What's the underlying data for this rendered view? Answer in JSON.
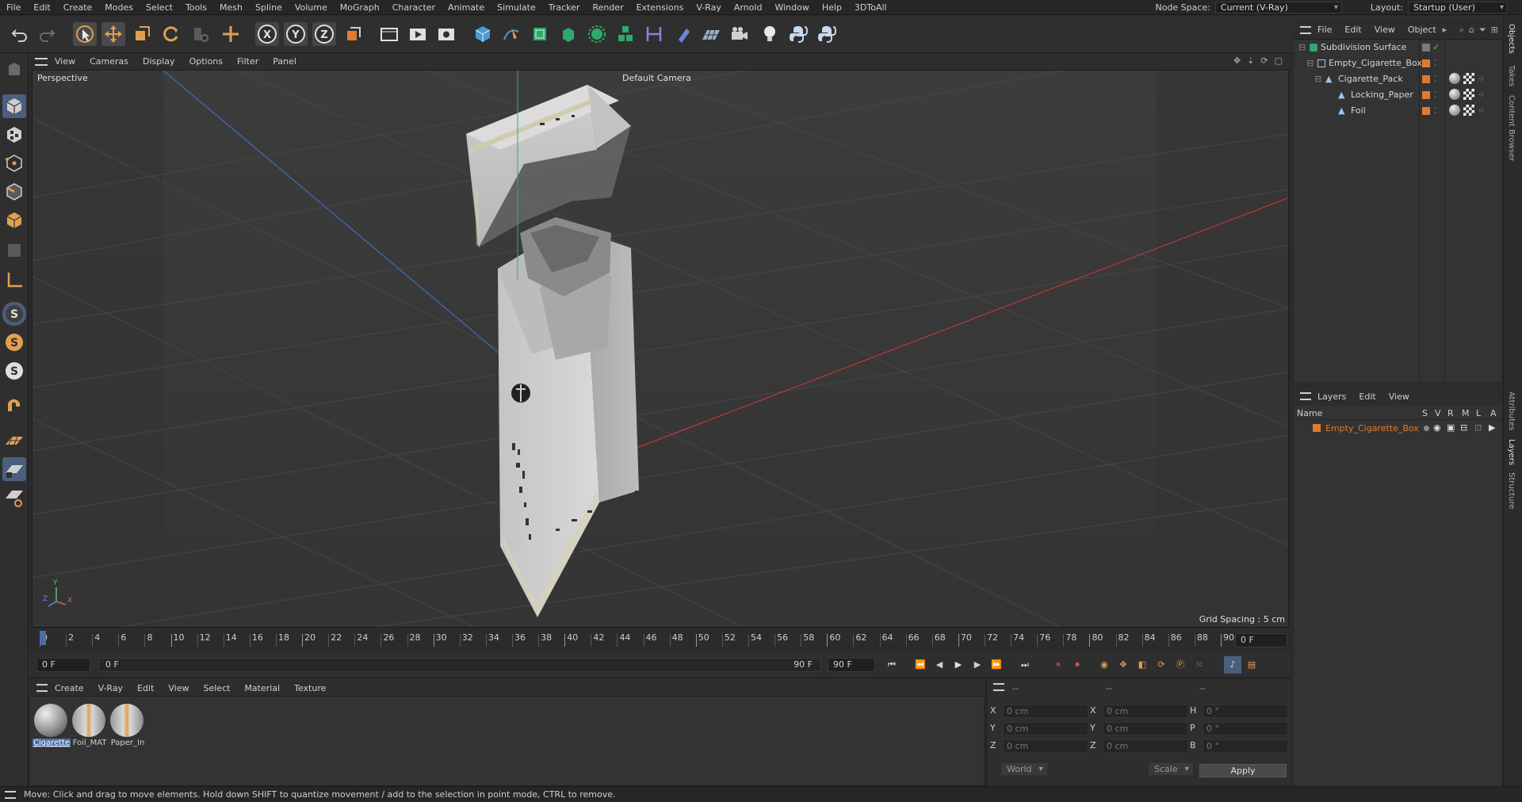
{
  "menubar": {
    "items": [
      "File",
      "Edit",
      "Create",
      "Modes",
      "Select",
      "Tools",
      "Mesh",
      "Spline",
      "Volume",
      "MoGraph",
      "Character",
      "Animate",
      "Simulate",
      "Tracker",
      "Render",
      "Extensions",
      "V-Ray",
      "Arnold",
      "Window",
      "Help",
      "3DToAll"
    ],
    "node_space_label": "Node Space:",
    "node_space_value": "Current (V-Ray)",
    "layout_label": "Layout:",
    "layout_value": "Startup (User)"
  },
  "viewport": {
    "menu": [
      "View",
      "Cameras",
      "Display",
      "Options",
      "Filter",
      "Panel"
    ],
    "view_name": "Perspective",
    "camera_label": "Default Camera",
    "grid_spacing": "Grid Spacing : 5 cm",
    "axis_labels": {
      "x": "X",
      "y": "Y",
      "z": "Z"
    }
  },
  "timeline": {
    "ticks": [
      "0",
      "2",
      "4",
      "6",
      "8",
      "10",
      "12",
      "14",
      "16",
      "18",
      "20",
      "22",
      "24",
      "26",
      "28",
      "30",
      "32",
      "34",
      "36",
      "38",
      "40",
      "42",
      "44",
      "46",
      "48",
      "50",
      "52",
      "54",
      "56",
      "58",
      "60",
      "62",
      "64",
      "66",
      "68",
      "70",
      "72",
      "74",
      "76",
      "78",
      "80",
      "82",
      "84",
      "86",
      "88",
      "90"
    ],
    "current_frame": "0 F",
    "start_frame": "0 F",
    "range_start": "0 F",
    "range_end": "90 F",
    "end_frame": "90 F"
  },
  "materials": {
    "menu": [
      "Create",
      "V-Ray",
      "Edit",
      "View",
      "Select",
      "Material",
      "Texture"
    ],
    "items": [
      {
        "name": "Cigarette"
      },
      {
        "name": "Foil_MAT"
      },
      {
        "name": "Paper_In"
      }
    ]
  },
  "coords": {
    "header": [
      "--",
      "--",
      "--"
    ],
    "rows": [
      {
        "pos_label": "X",
        "pos": "0 cm",
        "size_label": "X",
        "size": "0 cm",
        "rot_label": "H",
        "rot": "0 °"
      },
      {
        "pos_label": "Y",
        "pos": "0 cm",
        "size_label": "Y",
        "size": "0 cm",
        "rot_label": "P",
        "rot": "0 °"
      },
      {
        "pos_label": "Z",
        "pos": "0 cm",
        "size_label": "Z",
        "size": "0 cm",
        "rot_label": "B",
        "rot": "0 °"
      }
    ],
    "space": "World",
    "mode": "Scale",
    "apply": "Apply"
  },
  "objects": {
    "menu": [
      "File",
      "Edit",
      "View",
      "Object"
    ],
    "tree": [
      {
        "name": "Subdivision Surface",
        "indent": 0
      },
      {
        "name": "Empty_Cigarette_Box",
        "indent": 1
      },
      {
        "name": "Cigarette_Pack",
        "indent": 2
      },
      {
        "name": "Locking_Paper",
        "indent": 3
      },
      {
        "name": "Foil",
        "indent": 3
      }
    ]
  },
  "layers": {
    "menu": [
      "Layers",
      "Edit",
      "View"
    ],
    "columns": [
      "Name",
      "S",
      "V",
      "R",
      "M",
      "L",
      "A"
    ],
    "items": [
      {
        "name": "Empty_Cigarette_Box",
        "color": "#e07a2e"
      }
    ]
  },
  "side_tabs": [
    "Objects",
    "Takes",
    "Content Browser",
    "Attributes",
    "Layers",
    "Structure"
  ],
  "status": "Move: Click and drag to move elements. Hold down SHIFT to quantize movement / add to the selection in point mode, CTRL to remove.",
  "colors": {
    "accent": "#e07a2e",
    "selection": "#4a6fa5"
  }
}
